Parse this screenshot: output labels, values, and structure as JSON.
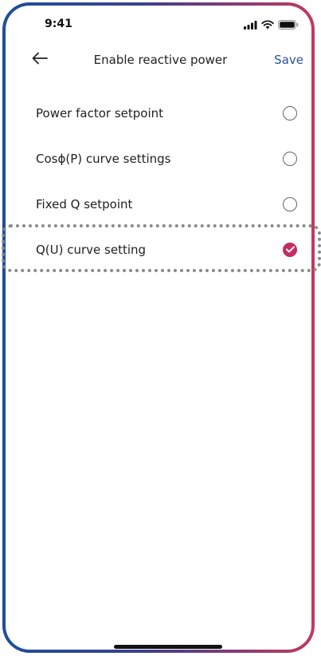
{
  "status_bar": {
    "time": "9:41",
    "icons": [
      "signal-icon",
      "wifi-icon",
      "battery-icon"
    ]
  },
  "header": {
    "title": "Enable reactive power",
    "save_label": "Save",
    "back_icon": "arrow-left-icon"
  },
  "options": [
    {
      "label": "Power factor setpoint",
      "selected": false
    },
    {
      "label": "Cosϕ(P) curve settings",
      "selected": false
    },
    {
      "label": "Fixed Q setpoint",
      "selected": false
    },
    {
      "label": "Q(U) curve setting",
      "selected": true
    }
  ],
  "colors": {
    "accent": "#c52c5f",
    "link": "#2c4f9b",
    "frame_left": "#1d4f9c",
    "frame_right": "#c23a5c"
  }
}
